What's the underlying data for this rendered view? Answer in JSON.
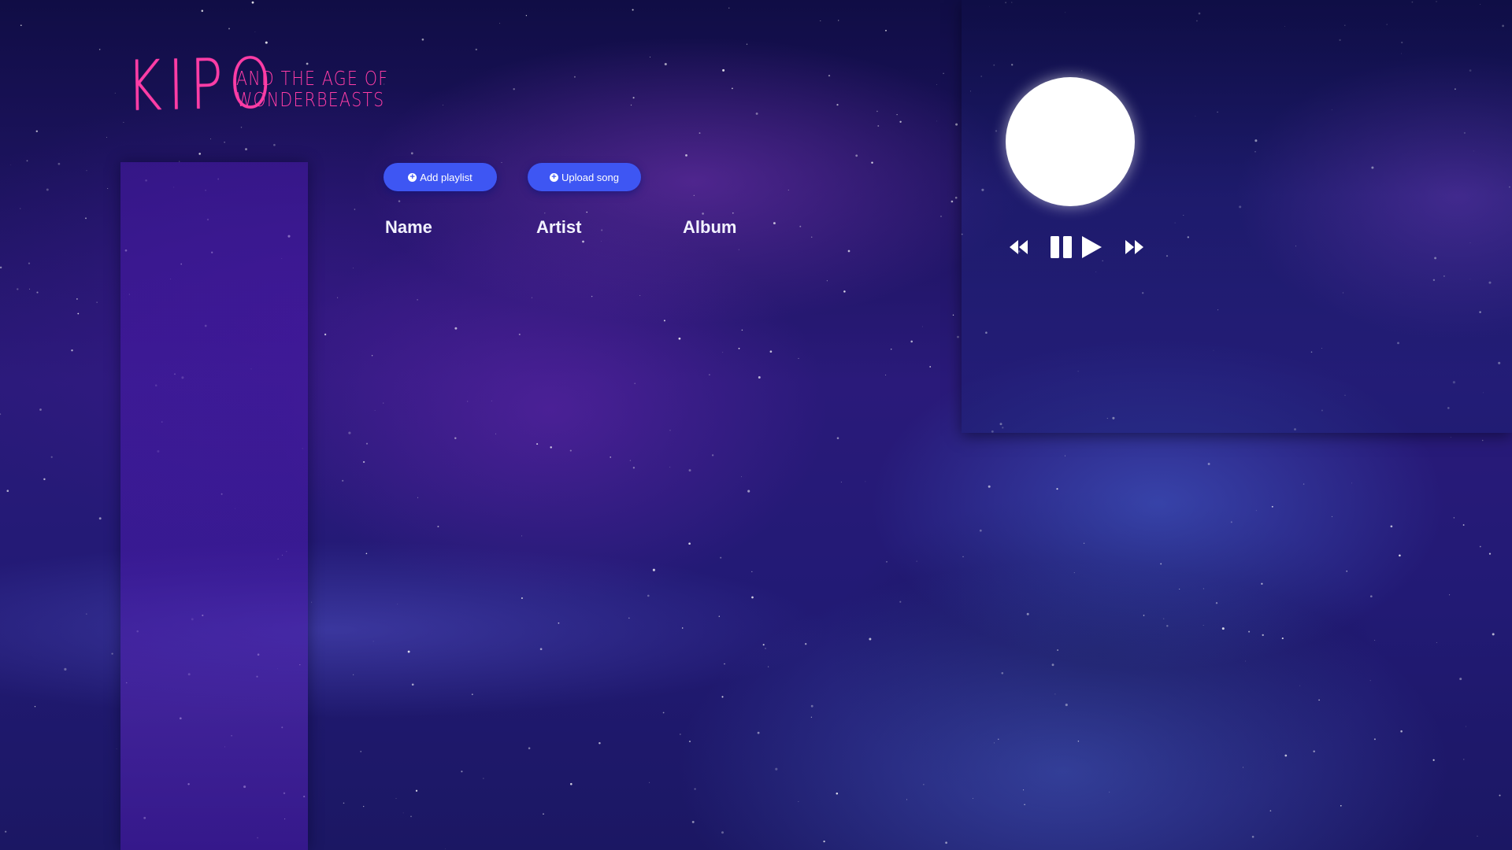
{
  "logo": {
    "title": "KIPO",
    "subtitle_line1": "AND THE AGE OF",
    "subtitle_line2": "WONDERBEASTS"
  },
  "actions": {
    "add_playlist_label": "Add playlist",
    "upload_song_label": "Upload song",
    "icon": "plus-circle-icon"
  },
  "table": {
    "columns": [
      "Name",
      "Artist",
      "Album"
    ]
  },
  "player": {
    "controls": [
      "rewind-icon",
      "pause-icon",
      "play-icon",
      "fast-forward-icon"
    ]
  },
  "colors": {
    "logo": "#ff3da6",
    "button": "#3e56f3",
    "text": "#ffffff"
  }
}
